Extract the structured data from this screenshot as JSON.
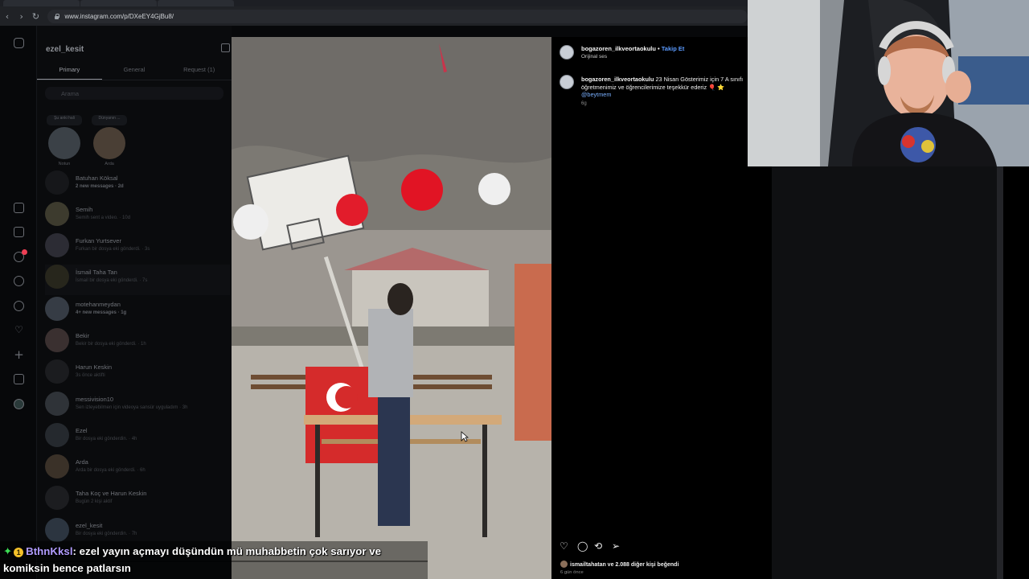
{
  "browser": {
    "url": "www.instagram.com/p/DXeEY4GjBu8/"
  },
  "rail_icons": [
    "instagram-icon",
    "home-icon",
    "reels-icon",
    "messages-icon",
    "search-icon",
    "explore-icon",
    "notifications-icon",
    "create-icon",
    "dashboard-icon",
    "profile-icon"
  ],
  "dm": {
    "username": "ezel_kesit",
    "tabs": [
      "Primary",
      "General",
      "Request (1)"
    ],
    "search_placeholder": "Arama",
    "stories": [
      {
        "note": "Şu anki hali",
        "name": "Notun"
      },
      {
        "note": "Dünyanın ...",
        "name": "Arda"
      }
    ],
    "conversations": [
      {
        "name": "Batuhan Köksal",
        "sub": "2 new messages · 2d",
        "bold": true
      },
      {
        "name": "Semih",
        "sub": "Semih sent a video. · 10d",
        "bold": false
      },
      {
        "name": "Furkan Yurtsever",
        "sub": "Furkan bir dosya eki gönderdi. · 3s",
        "bold": false
      },
      {
        "name": "İsmail Taha Tan",
        "sub": "İsmail bir dosya eki gönderdi. · 7s",
        "bold": false
      },
      {
        "name": "motehanmeydan",
        "sub": "4+ new messages · 1g",
        "bold": true
      },
      {
        "name": "Bekir",
        "sub": "Bekir bir dosya eki gönderdi. · 1h",
        "bold": false
      },
      {
        "name": "Harun Keskin",
        "sub": "3s önce aktifti",
        "bold": false
      },
      {
        "name": "messivision10",
        "sub": "Sen izleyebilmen için videoya sansür uyguladım · 3h",
        "bold": false
      },
      {
        "name": "Ezel",
        "sub": "Bir dosya eki gönderdin. · 4h",
        "bold": false
      },
      {
        "name": "Arda",
        "sub": "Arda bir dosya eki gönderdi. · 6h",
        "bold": false
      },
      {
        "name": "Taha Koç ve Harun Keskin",
        "sub": "Bugün 2 kişi aktif",
        "bold": false
      },
      {
        "name": "ezel_kesit",
        "sub": "Bir dosya eki gönderdin. · 7h",
        "bold": false
      }
    ]
  },
  "post": {
    "username": "bogazoren_ilkveortaokulu",
    "follow_label": "Takip Et",
    "audio": "Orijinal ses",
    "caption_user": "bogazoren_ilkveortaokulu",
    "caption_text": "23 Nisan Gösterimiz için 7 A sınıfı öğretmenimiz ve öğrencilerimize teşekkür ederiz 🎈 ⭐",
    "mention": "@beytmem",
    "caption_time": "6g",
    "likes_text": "ismailtahatan ve 2.088 diğer kişi beğendi",
    "post_time": "6 gün önce"
  },
  "chat": {
    "username": "BthnKksl",
    "message_line1": ": ezel yayın açmayı düşündün mü muhabbetin çok sarıyor ve",
    "message_line2": "komiksin bence patlarsın",
    "badge_count": "1"
  }
}
